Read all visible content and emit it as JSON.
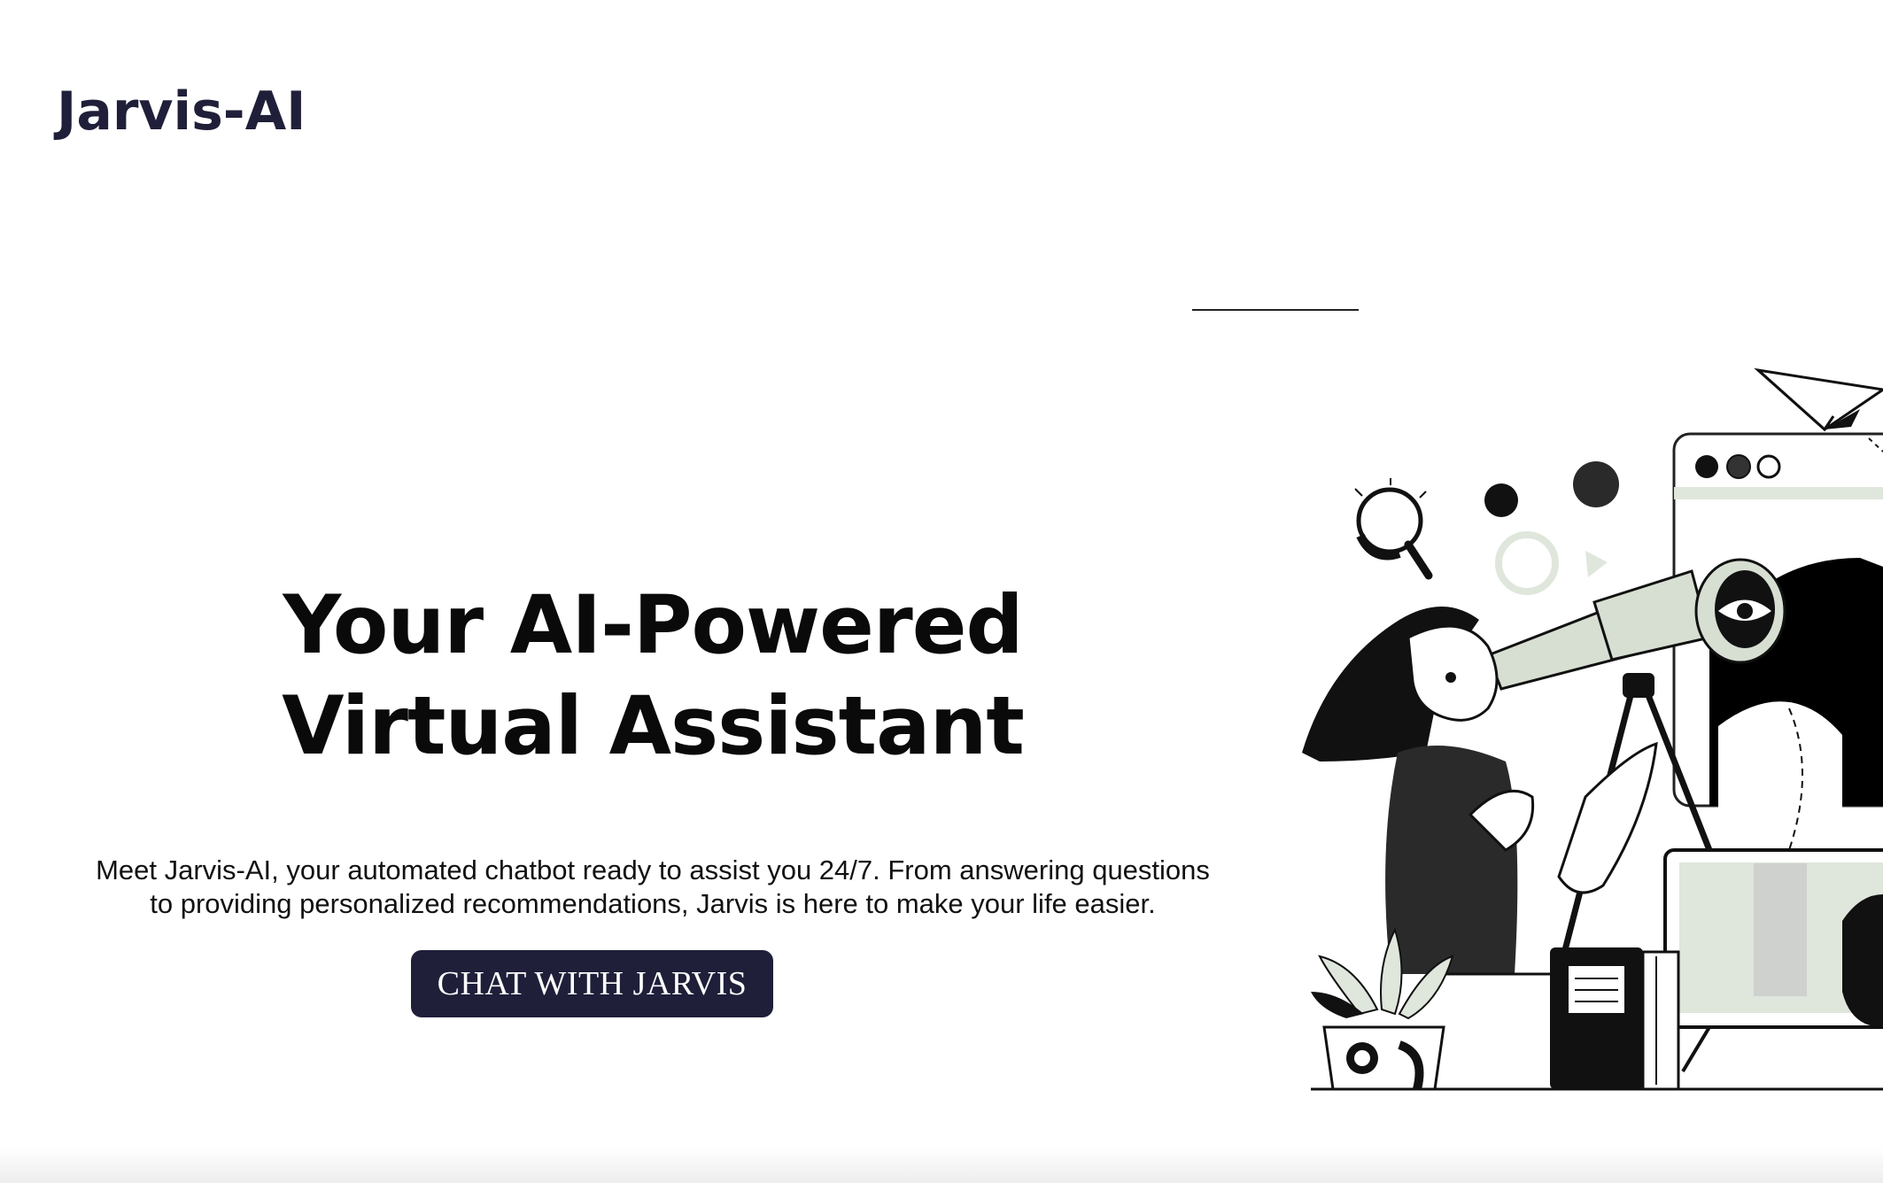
{
  "brand": {
    "name": "Jarvis-AI",
    "color": "#1f1f3a"
  },
  "hero": {
    "title_line1": "Your AI-Powered",
    "title_line2": "Virtual Assistant",
    "description_line1": "Meet Jarvis-AI, your automated chatbot ready to assist you 24/7. From answering questions",
    "description_line2": "to providing personalized recommendations, Jarvis is here to make your life easier.",
    "cta_label": "CHAT WITH JARVIS"
  },
  "illustration": {
    "icons": [
      "paper-plane-icon",
      "magnifier-icon",
      "telescope-icon",
      "eye-icon",
      "plant-icon",
      "book-icon",
      "monitor-icon"
    ]
  }
}
